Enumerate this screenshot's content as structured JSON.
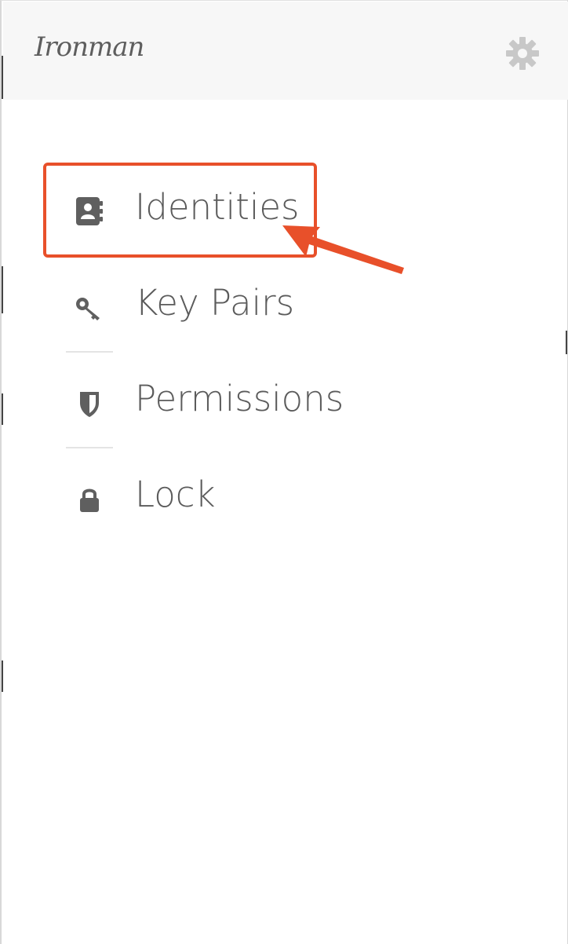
{
  "app": {
    "title": "Ironman"
  },
  "header": {
    "logo_text": "Ironman",
    "settings_icon": "gear-icon"
  },
  "nav": {
    "items": [
      {
        "label": "Identities",
        "icon": "address-book-icon"
      },
      {
        "label": "Key Pairs",
        "icon": "key-icon"
      },
      {
        "label": "Permissions",
        "icon": "shield-icon"
      },
      {
        "label": "Lock",
        "icon": "lock-icon"
      }
    ]
  },
  "colors": {
    "header_bg": "#f7f7f7",
    "text": "#5b5b5b",
    "icon": "#5f5f5f",
    "gear": "#c8c8c8",
    "annotation": "#e8502a",
    "divider": "#e4e4e4"
  }
}
